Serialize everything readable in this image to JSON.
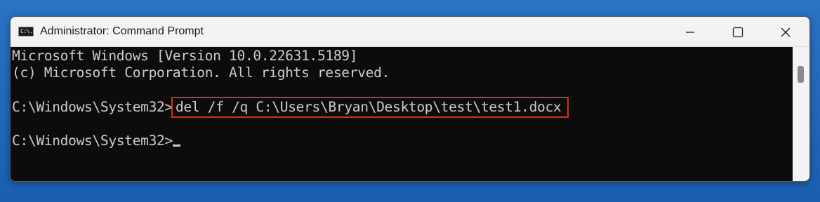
{
  "window": {
    "title": "Administrator: Command Prompt",
    "icon_name": "cmd-icon",
    "icon_text": "C:\\."
  },
  "controls": {
    "minimize": "minimize-icon",
    "maximize": "maximize-icon",
    "close": "close-icon"
  },
  "console": {
    "line1": "Microsoft Windows [Version 10.0.22631.5189]",
    "line2": "(c) Microsoft Corporation. All rights reserved.",
    "prompt1": "C:\\Windows\\System32>",
    "command": "del /f /q C:\\Users\\Bryan\\Desktop\\test\\test1.docx",
    "prompt2": "C:\\Windows\\System32>"
  },
  "colors": {
    "highlight_border": "#e02a14",
    "console_bg": "#0c0c0c",
    "console_text": "#cccccc",
    "desktop_bg": "#1b5eb0"
  }
}
